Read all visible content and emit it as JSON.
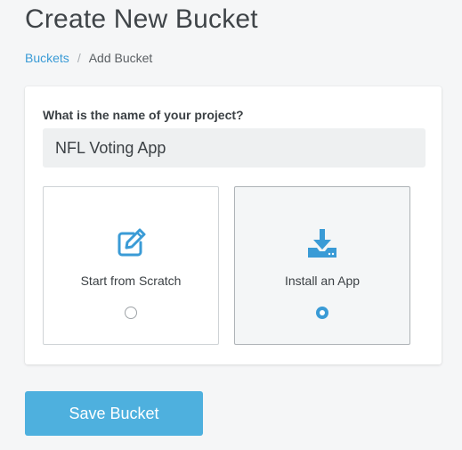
{
  "page": {
    "title": "Create New Bucket"
  },
  "breadcrumb": {
    "parent": "Buckets",
    "separator": "/",
    "current": "Add Bucket"
  },
  "form": {
    "project_label": "What is the name of your project?",
    "project_name_value": "NFL Voting App",
    "options": [
      {
        "label": "Start from Scratch",
        "icon": "edit-icon",
        "selected": false
      },
      {
        "label": "Install an App",
        "icon": "download-icon",
        "selected": true
      }
    ]
  },
  "actions": {
    "save_label": "Save Bucket"
  },
  "colors": {
    "accent": "#3a9bd6",
    "button": "#4eb0de",
    "text": "#3b4044",
    "background": "#f5f6f7"
  }
}
